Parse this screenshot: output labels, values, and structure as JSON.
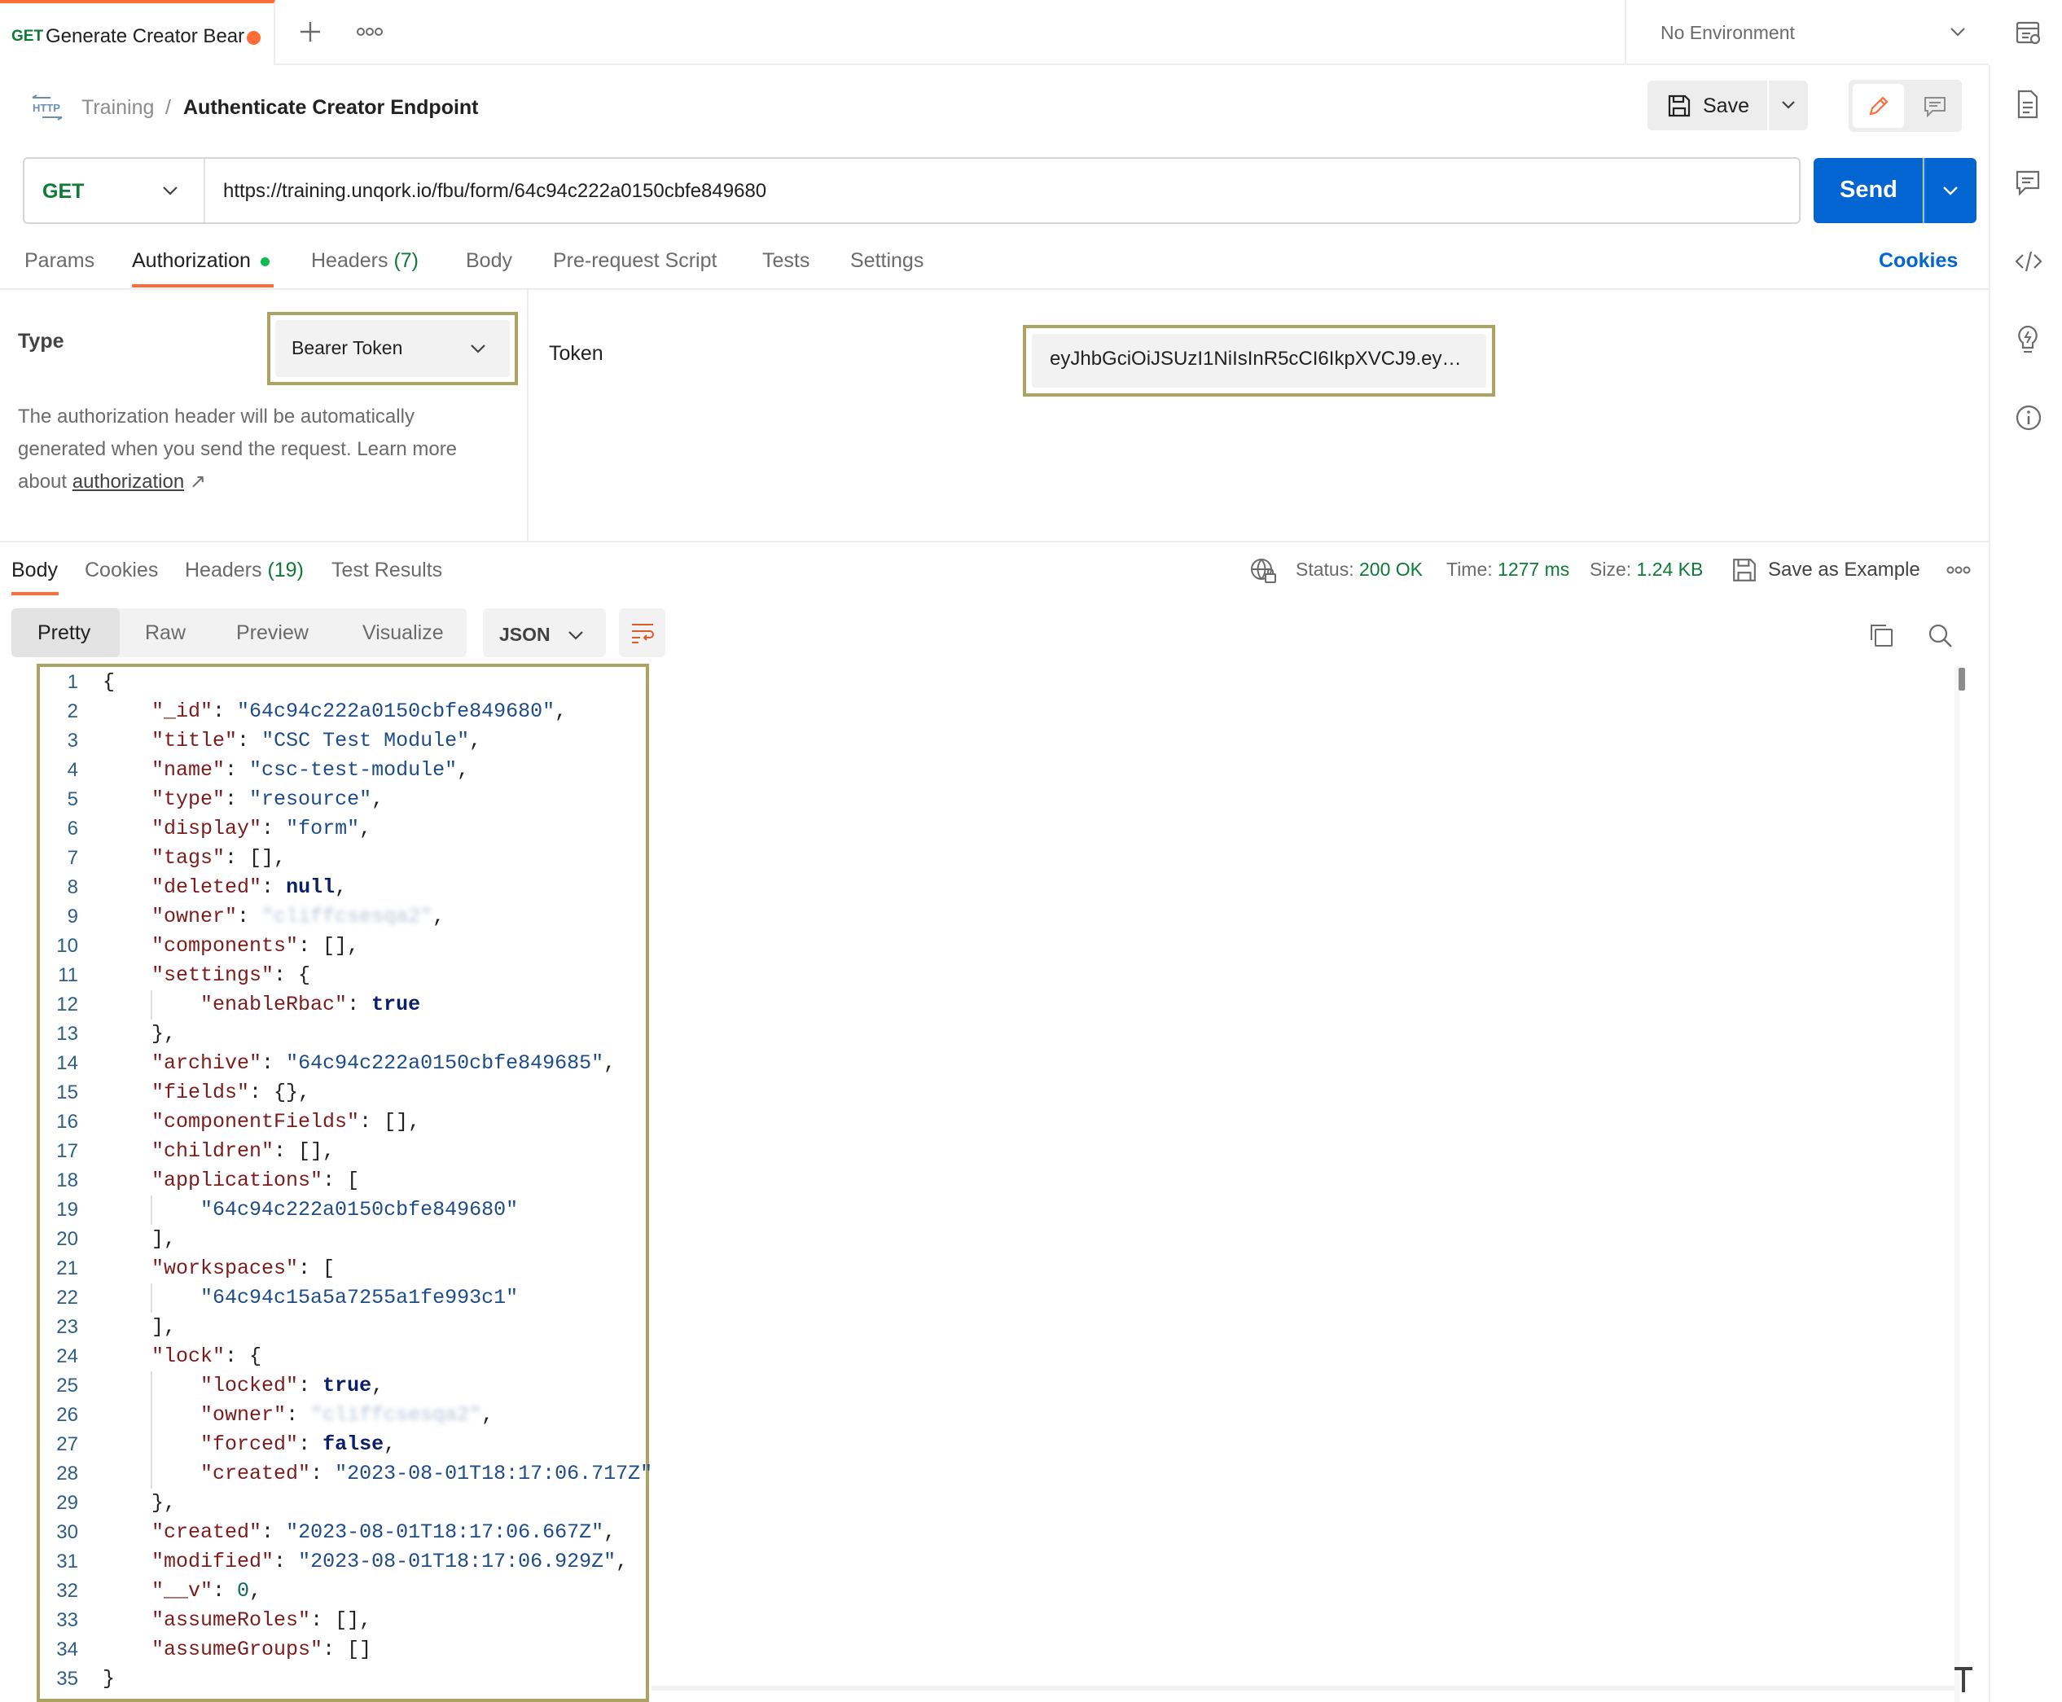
{
  "tab": {
    "method": "GET",
    "title": "Generate Creator Bear",
    "unsaved_dot_color": "#ff6c37"
  },
  "environment": {
    "label": "No Environment"
  },
  "breadcrumb": {
    "icon": "http-icon",
    "parent": "Training",
    "separator": "/",
    "current": "Authenticate Creator Endpoint"
  },
  "toolbar": {
    "save_label": "Save"
  },
  "request": {
    "method": "GET",
    "url": "https://training.unqork.io/fbu/form/64c94c222a0150cbfe849680",
    "send_label": "Send",
    "tabs": [
      {
        "label": "Params"
      },
      {
        "label": "Authorization"
      },
      {
        "label": "Headers",
        "count": "(7)"
      },
      {
        "label": "Body"
      },
      {
        "label": "Pre-request Script"
      },
      {
        "label": "Tests"
      },
      {
        "label": "Settings"
      }
    ],
    "cookies_label": "Cookies"
  },
  "auth": {
    "type_label": "Type",
    "type_value": "Bearer Token",
    "help_text": "The authorization header will be automatically generated when you send the request. Learn more about",
    "help_link": "authorization",
    "help_link_arrow": "↗",
    "token_label": "Token",
    "token_value": "eyJhbGciOiJSUzI1NiIsInR5cCI6IkpXVCJ9.ey…"
  },
  "response": {
    "tabs": [
      {
        "label": "Body"
      },
      {
        "label": "Cookies"
      },
      {
        "label": "Headers",
        "count": "(19)"
      },
      {
        "label": "Test Results"
      }
    ],
    "status_label": "Status:",
    "status_value": "200 OK",
    "time_label": "Time:",
    "time_value": "1277 ms",
    "size_label": "Size:",
    "size_value": "1.24 KB",
    "save_example_label": "Save as Example",
    "view_tabs": [
      {
        "label": "Pretty"
      },
      {
        "label": "Raw"
      },
      {
        "label": "Preview"
      },
      {
        "label": "Visualize"
      }
    ],
    "format": "JSON"
  },
  "code_lines": [
    {
      "n": "1",
      "t": "{"
    },
    {
      "n": "2",
      "t": "    \"_id\": \"64c94c222a0150cbfe849680\","
    },
    {
      "n": "3",
      "t": "    \"title\": \"CSC Test Module\","
    },
    {
      "n": "4",
      "t": "    \"name\": \"csc-test-module\","
    },
    {
      "n": "5",
      "t": "    \"type\": \"resource\","
    },
    {
      "n": "6",
      "t": "    \"display\": \"form\","
    },
    {
      "n": "7",
      "t": "    \"tags\": [],"
    },
    {
      "n": "8",
      "t": "    \"deleted\": null,"
    },
    {
      "n": "9",
      "t": "    \"owner\": \"cliffcsesqa2\","
    },
    {
      "n": "10",
      "t": "    \"components\": [],"
    },
    {
      "n": "11",
      "t": "    \"settings\": {"
    },
    {
      "n": "12",
      "t": "        \"enableRbac\": true"
    },
    {
      "n": "13",
      "t": "    },"
    },
    {
      "n": "14",
      "t": "    \"archive\": \"64c94c222a0150cbfe849685\","
    },
    {
      "n": "15",
      "t": "    \"fields\": {},"
    },
    {
      "n": "16",
      "t": "    \"componentFields\": [],"
    },
    {
      "n": "17",
      "t": "    \"children\": [],"
    },
    {
      "n": "18",
      "t": "    \"applications\": ["
    },
    {
      "n": "19",
      "t": "        \"64c94c222a0150cbfe849680\""
    },
    {
      "n": "20",
      "t": "    ],"
    },
    {
      "n": "21",
      "t": "    \"workspaces\": ["
    },
    {
      "n": "22",
      "t": "        \"64c94c15a5a7255a1fe993c1\""
    },
    {
      "n": "23",
      "t": "    ],"
    },
    {
      "n": "24",
      "t": "    \"lock\": {"
    },
    {
      "n": "25",
      "t": "        \"locked\": true,"
    },
    {
      "n": "26",
      "t": "        \"owner\": \"cliffcsesqa2\","
    },
    {
      "n": "27",
      "t": "        \"forced\": false,"
    },
    {
      "n": "28",
      "t": "        \"created\": \"2023-08-01T18:17:06.717Z\""
    },
    {
      "n": "29",
      "t": "    },"
    },
    {
      "n": "30",
      "t": "    \"created\": \"2023-08-01T18:17:06.667Z\","
    },
    {
      "n": "31",
      "t": "    \"modified\": \"2023-08-01T18:17:06.929Z\","
    },
    {
      "n": "32",
      "t": "    \"__v\": 0,"
    },
    {
      "n": "33",
      "t": "    \"assumeRoles\": [],"
    },
    {
      "n": "34",
      "t": "    \"assumeGroups\": []"
    },
    {
      "n": "35",
      "t": "}"
    }
  ],
  "colors": {
    "accent": "#ff6c37",
    "primary": "#0265d2",
    "success": "#0f7a35",
    "highlight_box": "#aca262"
  },
  "icons": {
    "new_tab": "plus-icon",
    "more": "ellipsis-icon",
    "env": "environment-quicklook-icon",
    "rail": [
      "documentation-icon",
      "comments-icon",
      "code-icon",
      "lightbulb-icon",
      "info-icon"
    ]
  }
}
